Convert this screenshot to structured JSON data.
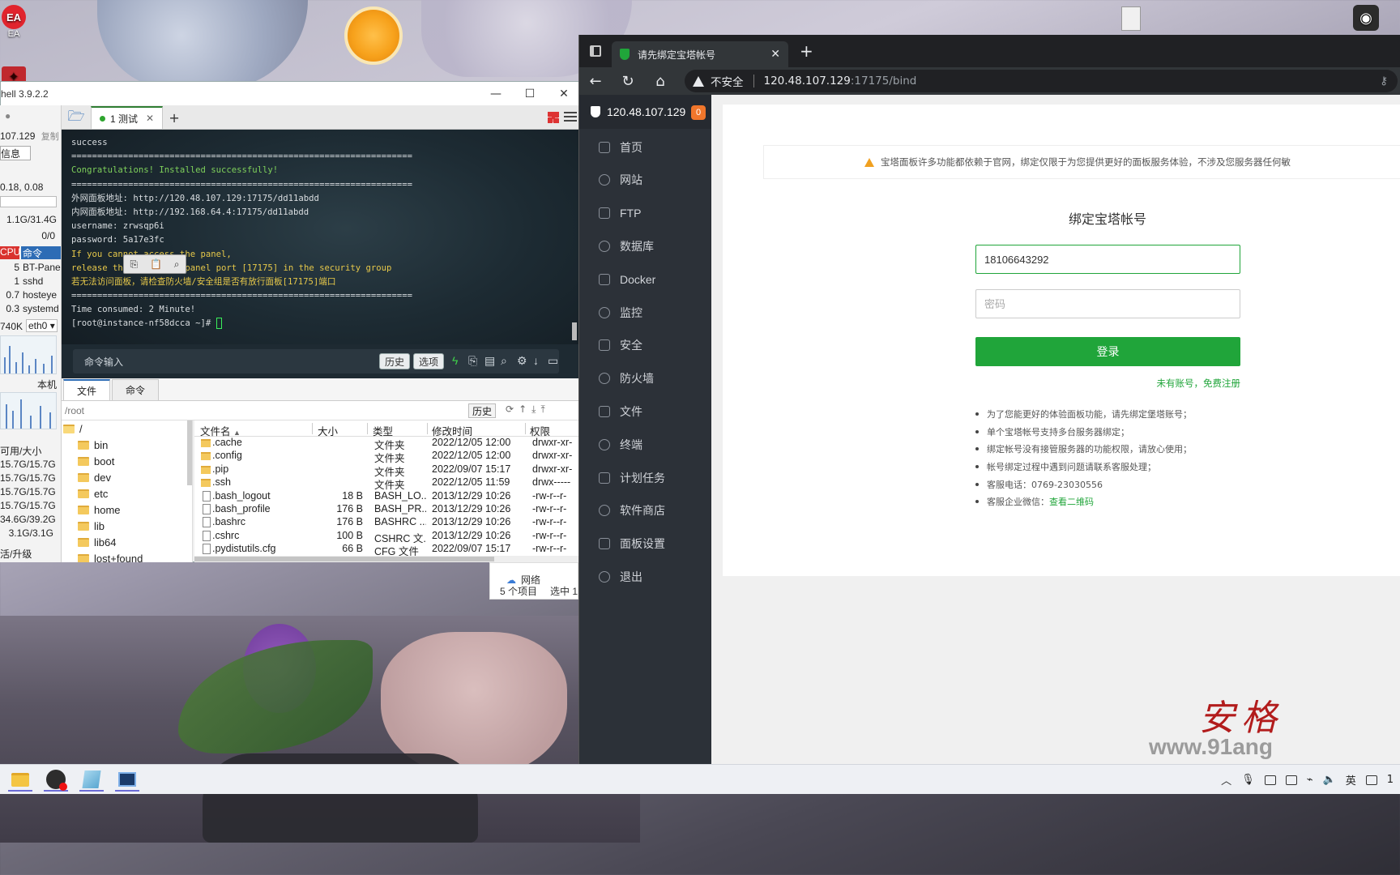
{
  "desktop": {
    "icons": [
      {
        "label": "EA"
      }
    ]
  },
  "xshell": {
    "title": "hell 3.9.2.2",
    "tab_label": "1 测试",
    "sidebar": {
      "ip": "107.129",
      "copy": "复制",
      "info_btn": "信息",
      "load": "0.18, 0.08",
      "mem": "1.1G/31.4G",
      "swap": "0/0",
      "proc_header": [
        "CPU",
        "命令"
      ],
      "procs": [
        {
          "cpu": "5",
          "cmd": "BT-Pane"
        },
        {
          "cpu": "1",
          "cmd": "sshd"
        },
        {
          "cpu": "0.7",
          "cmd": "hosteye"
        },
        {
          "cpu": "0.3",
          "cmd": "systemd"
        }
      ],
      "net_rate": "740K",
      "iface": "eth0",
      "local": "本机",
      "disk_header": "可用/大小",
      "disks": [
        "15.7G/15.7G",
        "15.7G/15.7G",
        "15.7G/15.7G",
        "15.7G/15.7G",
        "34.6G/39.2G",
        "3.1G/3.1G"
      ],
      "upgrade": "活/升级"
    },
    "terminal": {
      "lines": [
        {
          "t": "success",
          "c": ""
        },
        {
          "t": "==================================================================",
          "c": ""
        },
        {
          "t": "Congratulations! Installed successfully!",
          "c": "c-green"
        },
        {
          "t": "==================================================================",
          "c": ""
        },
        {
          "t": "外网面板地址: http://120.48.107.129:17175/dd11abdd",
          "c": ""
        },
        {
          "t": "内网面板地址: http://192.168.64.4:17175/dd11abdd",
          "c": ""
        },
        {
          "t": "username: zrwsqp6i",
          "c": ""
        },
        {
          "t": "password: 5a17e3fc",
          "c": ""
        },
        {
          "t": "If you cannot access the panel,",
          "c": "c-yellow"
        },
        {
          "t": "release the following panel port [17175] in the security group",
          "c": "c-yellow"
        },
        {
          "t": "若无法访问面板，请检查防火墙/安全组是否有放行面板[17175]端口",
          "c": "c-yellow"
        },
        {
          "t": "==================================================================",
          "c": ""
        },
        {
          "t": "Time consumed: 2 Minute!",
          "c": ""
        },
        {
          "t": "[root@instance-nf58dcca ~]# ",
          "c": ""
        }
      ]
    },
    "cmd_placeholder": "命令输入",
    "cmd_history": "历史",
    "cmd_options": "选项",
    "pane_tabs": [
      "文件",
      "命令"
    ],
    "path": "/root",
    "path_history": "历史",
    "tree": [
      "/",
      "bin",
      "boot",
      "dev",
      "etc",
      "home",
      "lib",
      "lib64",
      "lost+found"
    ],
    "file_columns": [
      "文件名",
      "大小",
      "类型",
      "修改时间",
      "权限"
    ],
    "files": [
      {
        "name": ".cache",
        "size": "",
        "type": "文件夹",
        "mtime": "2022/12/05 12:00",
        "perm": "drwxr-xr-",
        "dir": true
      },
      {
        "name": ".config",
        "size": "",
        "type": "文件夹",
        "mtime": "2022/12/05 12:00",
        "perm": "drwxr-xr-",
        "dir": true
      },
      {
        "name": ".pip",
        "size": "",
        "type": "文件夹",
        "mtime": "2022/09/07 15:17",
        "perm": "drwxr-xr-",
        "dir": true
      },
      {
        "name": ".ssh",
        "size": "",
        "type": "文件夹",
        "mtime": "2022/12/05 11:59",
        "perm": "drwx-----",
        "dir": true
      },
      {
        "name": ".bash_logout",
        "size": "18 B",
        "type": "BASH_LO...",
        "mtime": "2013/12/29 10:26",
        "perm": "-rw-r--r-",
        "dir": false
      },
      {
        "name": ".bash_profile",
        "size": "176 B",
        "type": "BASH_PR...",
        "mtime": "2013/12/29 10:26",
        "perm": "-rw-r--r-",
        "dir": false
      },
      {
        "name": ".bashrc",
        "size": "176 B",
        "type": "BASHRC ...",
        "mtime": "2013/12/29 10:26",
        "perm": "-rw-r--r-",
        "dir": false
      },
      {
        "name": ".cshrc",
        "size": "100 B",
        "type": "CSHRC 文...",
        "mtime": "2013/12/29 10:26",
        "perm": "-rw-r--r-",
        "dir": false
      },
      {
        "name": ".pydistutils.cfg",
        "size": "66 B",
        "type": "CFG 文件",
        "mtime": "2022/09/07 15:17",
        "perm": "-rw-r--r-",
        "dir": false
      }
    ]
  },
  "explorer": {
    "net": "网络",
    "count": "5 个项目",
    "selected": "选中 1"
  },
  "browser": {
    "tab_title": "请先绑定宝塔帐号",
    "insecure": "不安全",
    "url_host": "120.48.107.129",
    "url_rest": ":17175/bind"
  },
  "bt": {
    "brand": "120.48.107.129",
    "badge": "0",
    "menu": [
      "首页",
      "网站",
      "FTP",
      "数据库",
      "Docker",
      "监控",
      "安全",
      "防火墙",
      "文件",
      "终端",
      "计划任务",
      "软件商店",
      "面板设置",
      "退出"
    ],
    "notice": "宝塔面板许多功能都依赖于官网，绑定仅限于为您提供更好的面板服务体验，不涉及您服务器任何敏",
    "title": "绑定宝塔帐号",
    "phone_value": "18106643292",
    "password_placeholder": "密码",
    "login": "登录",
    "register": "未有账号，免费注册",
    "tips": [
      "为了您能更好的体验面板功能，请先绑定堡塔账号；",
      "单个宝塔帐号支持多台服务器绑定；",
      "绑定帐号没有接管服务器的功能权限，请放心使用；",
      "帐号绑定过程中遇到问题请联系客服处理；",
      "客服电话：0769-23030556"
    ],
    "wechat_label": "客服企业微信：",
    "wechat_link": "查看二维码"
  },
  "watermark": {
    "cn": "安格",
    "url": "www.91ang"
  },
  "taskbar": {
    "ime": "英",
    "clock": "1"
  }
}
